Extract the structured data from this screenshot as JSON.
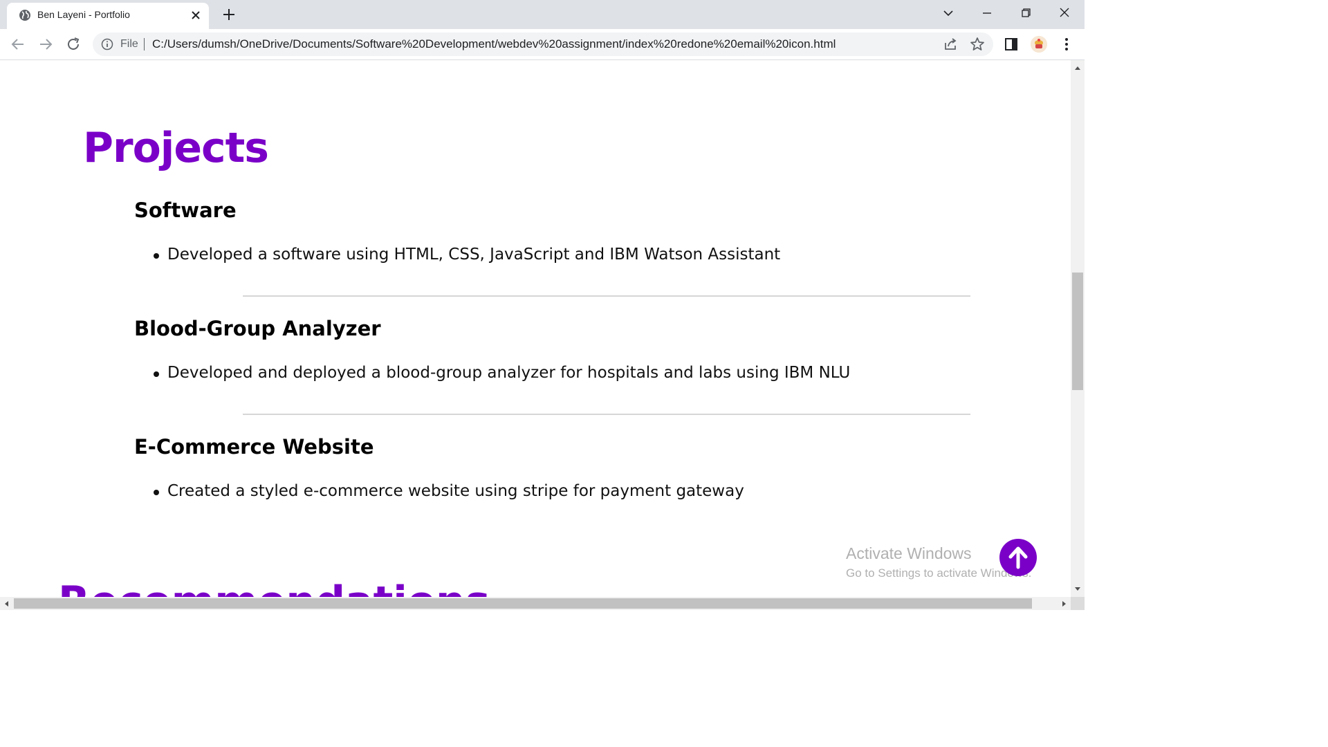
{
  "browser": {
    "tab_title": "Ben Layeni - Portfolio",
    "address_scheme": "File",
    "url": "C:/Users/dumsh/OneDrive/Documents/Software%20Development/webdev%20assignment/index%20redone%20email%20icon.html"
  },
  "page": {
    "section_title": "Projects",
    "projects": [
      {
        "title": "Software",
        "bullet": "Developed a software using HTML, CSS, JavaScript and IBM Watson Assistant"
      },
      {
        "title": "Blood-Group Analyzer",
        "bullet": "Developed and deployed a blood-group analyzer for hospitals and labs using IBM NLU"
      },
      {
        "title": "E-Commerce Website",
        "bullet": "Created a styled e-commerce website using stripe for payment gateway"
      }
    ],
    "next_section_partial": "Recommendations"
  },
  "watermark": {
    "title": "Activate Windows",
    "subtitle": "Go to Settings to activate Windows."
  },
  "colors": {
    "accent": "#7a00c8"
  }
}
